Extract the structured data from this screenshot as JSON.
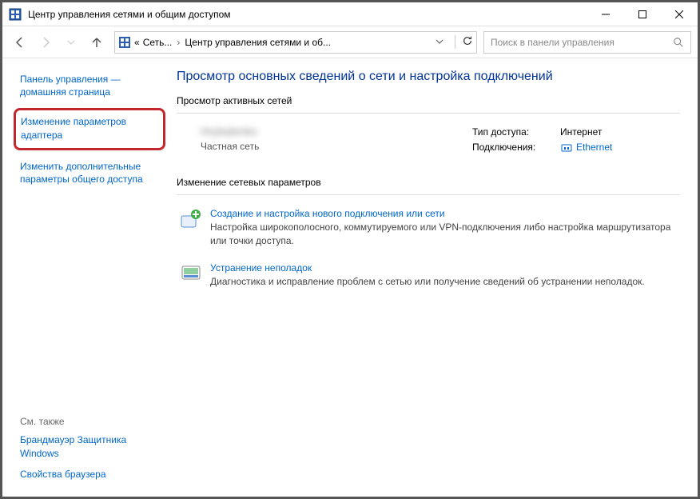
{
  "window": {
    "title": "Центр управления сетями и общим доступом"
  },
  "breadcrumb": {
    "root_prefix": "«",
    "root": "Сеть...",
    "current": "Центр управления сетями и об..."
  },
  "search": {
    "placeholder": "Поиск в панели управления"
  },
  "sidebar": {
    "home": "Панель управления — домашняя страница",
    "adapter": "Изменение параметров адаптера",
    "sharing": "Изменить дополнительные параметры общего доступа",
    "seealso_label": "См. также",
    "firewall": "Брандмауэр Защитника Windows",
    "browser_props": "Свойства браузера"
  },
  "main": {
    "title": "Просмотр основных сведений о сети и настройка подключений",
    "active_legend": "Просмотр активных сетей",
    "network_name": "Hrybalenko",
    "network_type": "Частная сеть",
    "access_label": "Тип доступа:",
    "access_value": "Интернет",
    "conn_label": "Подключения:",
    "conn_value": "Ethernet",
    "change_legend": "Изменение сетевых параметров",
    "task1_title": "Создание и настройка нового подключения или сети",
    "task1_desc": "Настройка широкополосного, коммутируемого или VPN-подключения либо настройка маршрутизатора или точки доступа.",
    "task2_title": "Устранение неполадок",
    "task2_desc": "Диагностика и исправление проблем с сетью или получение сведений об устранении неполадок."
  }
}
